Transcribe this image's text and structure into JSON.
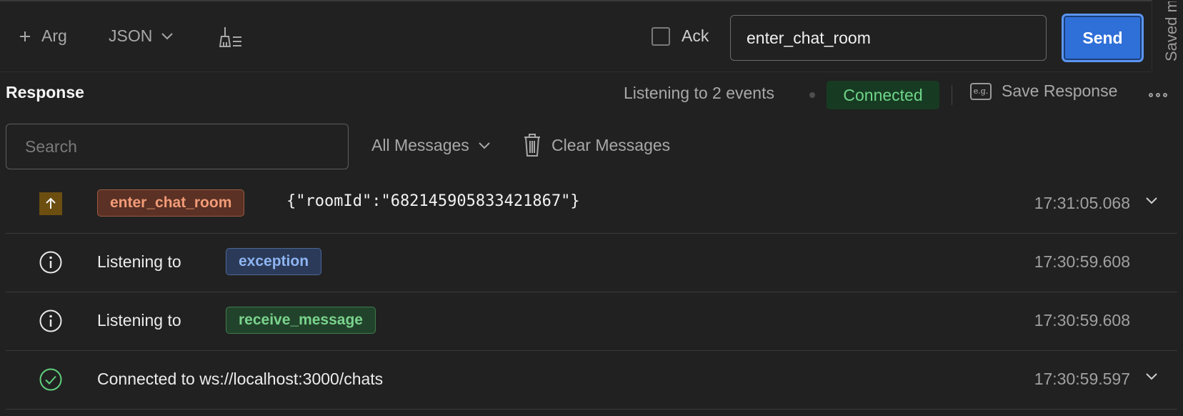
{
  "toolbar": {
    "add_arg_label": "Arg",
    "format_label": "JSON",
    "ack_label": "Ack",
    "event_name_value": "enter_chat_room",
    "send_label": "Send"
  },
  "side_panel": {
    "label": "Saved m"
  },
  "response": {
    "title": "Response",
    "listening_text": "Listening to 2 events",
    "status_badge": "Connected",
    "save_response_label": "Save Response",
    "save_icon_text": "e.g."
  },
  "filters": {
    "search_placeholder": "Search",
    "filter_label": "All Messages",
    "clear_label": "Clear Messages"
  },
  "messages": [
    {
      "type": "emit",
      "event": "enter_chat_room",
      "payload": "{\"roomId\":\"682145905833421867\"}",
      "time": "17:31:05.068",
      "expandable": true
    },
    {
      "type": "info",
      "prefix": "Listening to",
      "event": "exception",
      "time": "17:30:59.608"
    },
    {
      "type": "info",
      "prefix": "Listening to",
      "event": "receive_message",
      "time": "17:30:59.608"
    },
    {
      "type": "success",
      "text": "Connected to ws://localhost:3000/chats",
      "time": "17:30:59.597",
      "expandable": true
    }
  ],
  "colors": {
    "background": "#212121",
    "send_button": "#2f6fd8",
    "connected_text": "#6fd58a",
    "emit_tag": "#f29b78",
    "exception_tag": "#8fb4f2",
    "receive_tag": "#7ad38d"
  }
}
